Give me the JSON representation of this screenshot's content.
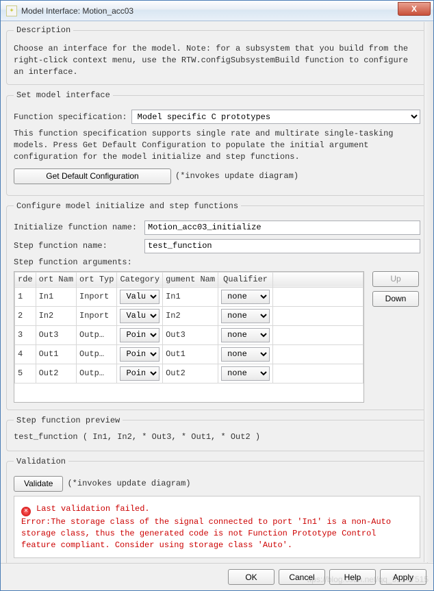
{
  "window": {
    "title": "Model Interface: Motion_acc03",
    "close": "X"
  },
  "description": {
    "legend": "Description",
    "text": "Choose an interface for the model. Note: for a subsystem that you build from the right-click context menu, use the RTW.configSubsystemBuild function to configure an interface."
  },
  "setmodel": {
    "legend": "Set model interface",
    "funcspec_label": "Function specification:",
    "funcspec_value": "Model specific C prototypes",
    "note": "This function specification supports single rate and multirate single-tasking models. Press Get Default Configuration to populate the initial argument configuration for the model initialize and step functions.",
    "getdefault_btn": "Get Default Configuration",
    "getdefault_note": "(*invokes update diagram)"
  },
  "configure": {
    "legend": "Configure model initialize and step functions",
    "init_label": "Initialize function name:",
    "init_value": "Motion_acc03_initialize",
    "step_label": "Step function name:",
    "step_value": "test_function",
    "args_label": "Step function arguments:",
    "headers": [
      "rde",
      "ort Nam",
      "ort Typ",
      "Category",
      "gument Nam",
      "Qualifier"
    ],
    "rows": [
      {
        "order": "1",
        "portname": "In1",
        "porttype": "Inport",
        "category": "Value",
        "argname": "In1",
        "qualifier": "none"
      },
      {
        "order": "2",
        "portname": "In2",
        "porttype": "Inport",
        "category": "Value",
        "argname": "In2",
        "qualifier": "none"
      },
      {
        "order": "3",
        "portname": "Out3",
        "porttype": "Outp…",
        "category": "Point",
        "argname": "Out3",
        "qualifier": "none"
      },
      {
        "order": "4",
        "portname": "Out1",
        "porttype": "Outp…",
        "category": "Point",
        "argname": "Out1",
        "qualifier": "none"
      },
      {
        "order": "5",
        "portname": "Out2",
        "porttype": "Outp…",
        "category": "Point",
        "argname": "Out2",
        "qualifier": "none"
      }
    ],
    "up_btn": "Up",
    "down_btn": "Down"
  },
  "preview": {
    "legend": "Step function preview",
    "text": "test_function ( In1, In2, * Out3, * Out1, * Out2 )"
  },
  "validation": {
    "legend": "Validation",
    "btn": "Validate",
    "note": "(*invokes update diagram)",
    "err_header": "Last validation failed.",
    "err_body": "Error:The storage class of the signal connected to port 'In1' is a non-Auto storage class, thus the generated code is not Function Prototype Control feature compliant. Consider using storage class 'Auto'."
  },
  "footer": {
    "ok": "OK",
    "cancel": "Cancel",
    "help": "Help",
    "apply": "Apply"
  },
  "watermark": "ttps://blog.csdn.net/qq_31547515"
}
